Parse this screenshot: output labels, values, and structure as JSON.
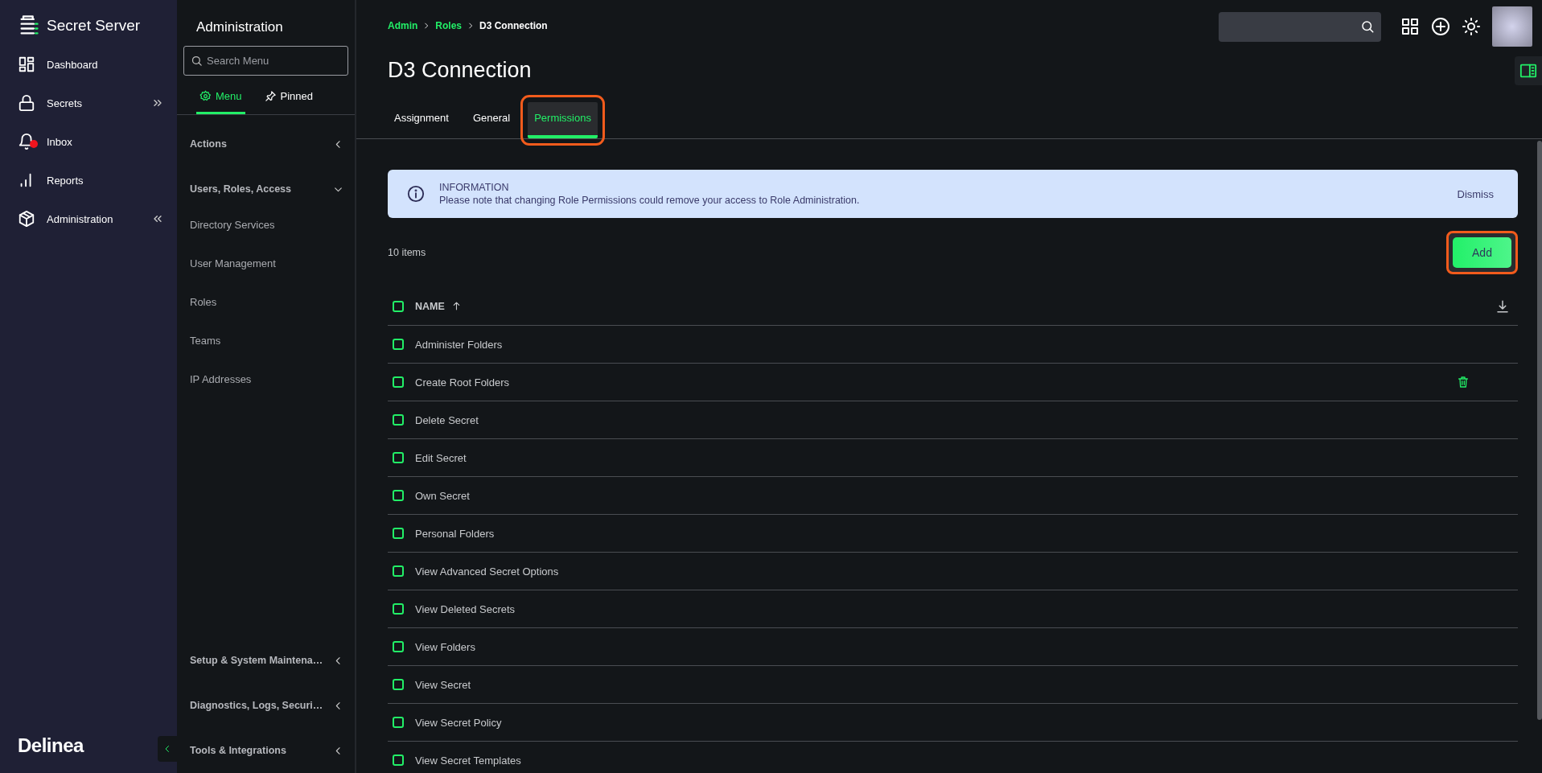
{
  "app": {
    "name": "Secret Server",
    "brand": "Delinea"
  },
  "nav": [
    {
      "label": "Dashboard",
      "notification": false
    },
    {
      "label": "Secrets",
      "notification": false
    },
    {
      "label": "Inbox",
      "notification": true
    },
    {
      "label": "Reports",
      "notification": false
    },
    {
      "label": "Administration",
      "notification": false
    }
  ],
  "menu": {
    "title": "Administration",
    "search": {
      "placeholder": "Search Menu"
    },
    "tabs": [
      {
        "label": "Menu",
        "selected": true
      },
      {
        "label": "Pinned",
        "selected": false
      }
    ],
    "sections": [
      {
        "label": "Actions",
        "expanded": false
      },
      {
        "label": "Users, Roles, Access",
        "expanded": true,
        "children": [
          {
            "label": "Directory Services"
          },
          {
            "label": "User Management"
          },
          {
            "label": "Roles"
          },
          {
            "label": "Teams"
          },
          {
            "label": "IP Addresses"
          }
        ]
      },
      {
        "label": "Setup & System Maintena…",
        "expanded": false
      },
      {
        "label": "Diagnostics, Logs, Securi…",
        "expanded": false
      },
      {
        "label": "Tools & Integrations",
        "expanded": false
      }
    ]
  },
  "breadcrumb": [
    {
      "label": "Admin",
      "kind": "link"
    },
    {
      "label": "Roles",
      "kind": "link"
    },
    {
      "label": "D3 Connection",
      "kind": "current"
    }
  ],
  "page": {
    "title": "D3 Connection"
  },
  "tabs": [
    {
      "label": "Assignment",
      "selected": false,
      "highlighted": false
    },
    {
      "label": "General",
      "selected": false,
      "highlighted": false
    },
    {
      "label": "Permissions",
      "selected": true,
      "highlighted": true
    }
  ],
  "alert": {
    "title": "INFORMATION",
    "message": "Please note that changing Role Permissions could remove your access to Role Administration.",
    "action": "Dismiss"
  },
  "item_count": "10 items",
  "add_button": {
    "label": "Add",
    "highlighted": true
  },
  "table": {
    "select_all": {
      "checked": false
    },
    "columns": [
      {
        "label": "NAME"
      }
    ],
    "rows": [
      {
        "name": "Administer Folders",
        "checked": false,
        "show_delete": false
      },
      {
        "name": "Create Root Folders",
        "checked": false,
        "show_delete": true
      },
      {
        "name": "Delete Secret",
        "checked": false,
        "show_delete": false
      },
      {
        "name": "Edit Secret",
        "checked": false,
        "show_delete": false
      },
      {
        "name": "Own Secret",
        "checked": false,
        "show_delete": false
      },
      {
        "name": "Personal Folders",
        "checked": false,
        "show_delete": false
      },
      {
        "name": "View Advanced Secret Options",
        "checked": false,
        "show_delete": false
      },
      {
        "name": "View Deleted Secrets",
        "checked": false,
        "show_delete": false
      },
      {
        "name": "View Folders",
        "checked": false,
        "show_delete": false
      },
      {
        "name": "View Secret",
        "checked": false,
        "show_delete": false
      },
      {
        "name": "View Secret Policy",
        "checked": false,
        "show_delete": false
      },
      {
        "name": "View Secret Templates",
        "checked": false,
        "show_delete": false
      }
    ]
  }
}
